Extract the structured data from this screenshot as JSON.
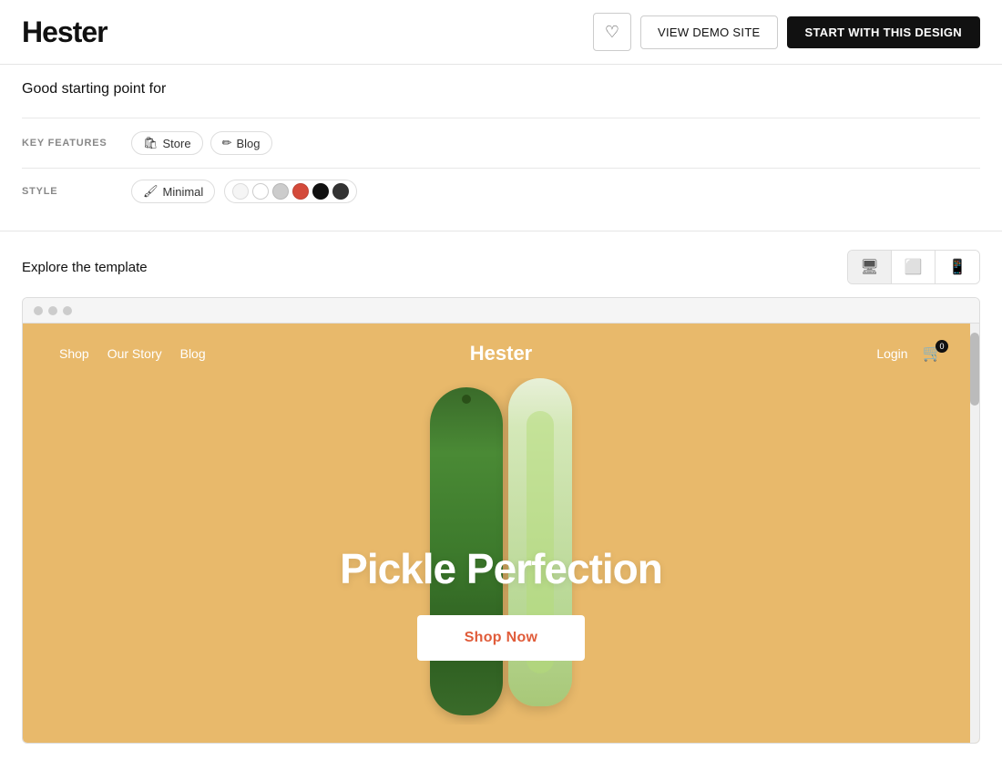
{
  "header": {
    "title": "Hester",
    "heart_label": "♡",
    "demo_btn": "VIEW DEMO SITE",
    "start_btn": "START WITH THIS DESIGN"
  },
  "meta": {
    "good_for_label": "Good starting point for",
    "key_features_label": "KEY FEATURES",
    "features": [
      {
        "icon": "🛍",
        "label": "Store"
      },
      {
        "icon": "✏",
        "label": "Blog"
      }
    ],
    "style_label": "STYLE",
    "style_tag": "Minimal",
    "colors": [
      {
        "hex": "#f5f5f5"
      },
      {
        "hex": "#ffffff"
      },
      {
        "hex": "#cccccc"
      },
      {
        "hex": "#d44a3a"
      },
      {
        "hex": "#111111"
      },
      {
        "hex": "#333333"
      }
    ]
  },
  "explore": {
    "title": "Explore the template",
    "devices": [
      {
        "icon": "🖥",
        "label": "desktop",
        "active": true
      },
      {
        "icon": "💻",
        "label": "tablet",
        "active": false
      },
      {
        "icon": "📱",
        "label": "mobile",
        "active": false
      }
    ]
  },
  "template": {
    "nav": {
      "links": [
        "Shop",
        "Our Story",
        "Blog"
      ],
      "brand": "Hester",
      "login": "Login",
      "cart_count": "0"
    },
    "hero": {
      "headline": "Pickle Perfection",
      "cta": "Shop Now"
    },
    "bg_color": "#E8B96B"
  }
}
